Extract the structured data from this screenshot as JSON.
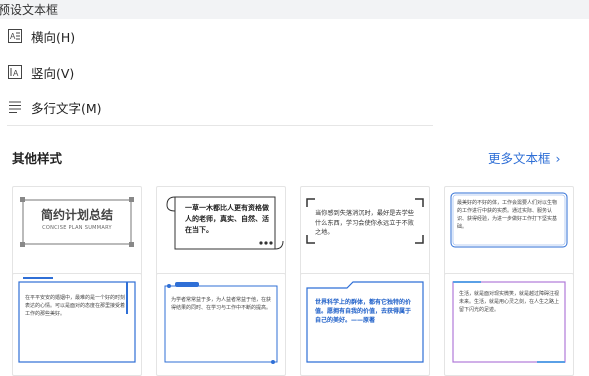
{
  "header": {
    "title": "预设文本框"
  },
  "options": [
    {
      "label": "横向(H)",
      "icon": "horizontal-textbox-icon"
    },
    {
      "label": "竖向(V)",
      "icon": "vertical-textbox-icon"
    },
    {
      "label": "多行文字(M)",
      "icon": "multiline-text-icon"
    }
  ],
  "styles": {
    "title": "其他样式",
    "more_label": "更多文本框",
    "more_icon": "chevron-right-icon"
  },
  "cards": [
    {
      "title": "简约计划总结",
      "subtitle": "CONCISE PLAN SUMMARY"
    },
    {
      "text": "一草一木都比人更有资格做人的老师，真实、自然、活在当下。"
    },
    {
      "text": "当你感到失落消沉时，最好是去学些什么东西，学习会使你永远立于不败之地。"
    },
    {
      "text": "最美好的不好的体，工作会需要人们对以生物的工作进行中获的实质。通过实际、服务认识、获得经验，为进一步做好工作打下坚实基础。"
    },
    {
      "text": "在平平安安的婚姻中，最难的是一个好的时刻表达的心情。可以是面对的态度在那里接受着工作的那些美好。"
    },
    {
      "text": "为学者常常益于多，为人益者常益于他，在获得结果的同时、在学习与工作中不断的提高。"
    },
    {
      "text": "世界科学上的群体，都有它独特的价值。愿拥有自我的价值，去获得属于自己的美好。——原著"
    },
    {
      "text": "生活，就是面对现实微笑，就是越过障碍注视未来。生活，就是用心灵之剑，在人生之路上留下闪光的足迹。"
    }
  ],
  "colors": {
    "accent": "#2f6fd6",
    "header_bg": "#f2f3f5"
  }
}
